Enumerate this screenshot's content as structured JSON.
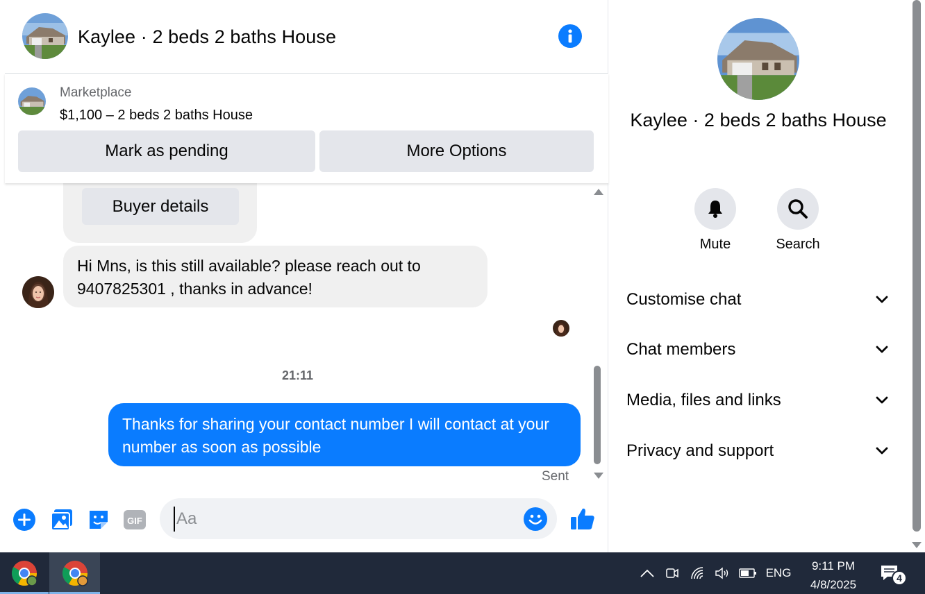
{
  "header": {
    "title": "Kaylee · 2 beds 2 baths House"
  },
  "listing": {
    "source": "Marketplace",
    "price_title": "$1,100 – 2 beds 2 baths House",
    "mark_pending_label": "Mark as pending",
    "more_options_label": "More Options"
  },
  "messages": {
    "buyer_details_label": "Buyer details",
    "incoming_text": "Hi Mns, is this still available? please reach out to 9407825301 , thanks in advance!",
    "timestamp": "21:11",
    "outgoing_text": "Thanks for sharing your contact number I will contact at your number as soon as possible",
    "status": "Sent"
  },
  "composer": {
    "placeholder": "Aa",
    "gif_label": "GIF"
  },
  "details": {
    "name": "Kaylee · 2 beds 2 baths House",
    "mute_label": "Mute",
    "search_label": "Search",
    "sections": [
      {
        "label": "Customise chat"
      },
      {
        "label": "Chat members"
      },
      {
        "label": "Media, files and links"
      },
      {
        "label": "Privacy and support"
      }
    ]
  },
  "taskbar": {
    "language": "ENG",
    "time": "9:11 PM",
    "date": "4/8/2025",
    "notification_count": "4"
  },
  "colors": {
    "messenger_blue": "#0a7cff",
    "bubble_grey": "#f0f0f0",
    "button_grey": "#e4e6eb",
    "secondary_text": "#65676b",
    "taskbar": "#20293a"
  }
}
